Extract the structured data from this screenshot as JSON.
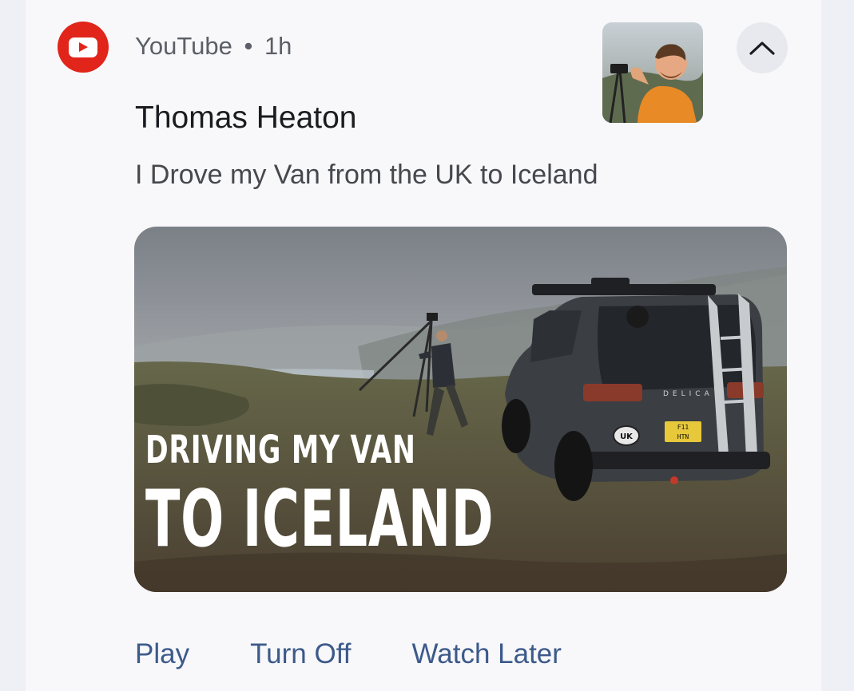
{
  "notification": {
    "app_name": "YouTube",
    "separator": "•",
    "time": "1h",
    "app_icon": "youtube-play-icon",
    "expand_icon": "chevron-up-icon",
    "title": "Thomas Heaton",
    "text": "I Drove my Van from the UK to Iceland",
    "thumbnail": {
      "overlay_line1": "DRIVING MY VAN",
      "overlay_line2": "TO ICELAND",
      "badge": "UK",
      "plate": "F11 HTN"
    },
    "actions": [
      "Play",
      "Turn Off",
      "Watch Later"
    ],
    "colors": {
      "accent": "#e1251b",
      "action": "#3c5a8a",
      "card": "#f8f8fb"
    }
  }
}
